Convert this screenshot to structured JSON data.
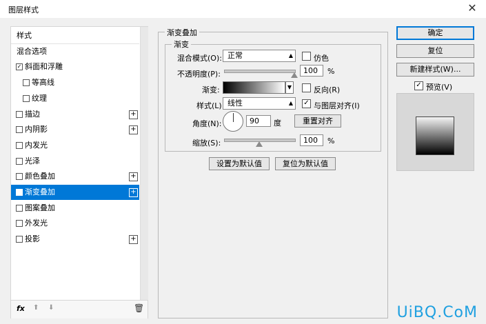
{
  "window": {
    "title": "图层样式",
    "close_glyph": "✕"
  },
  "styles_list": {
    "items": [
      {
        "label": "样式",
        "checkbox": false,
        "checked": false,
        "plus": false,
        "indent": false,
        "selected": false
      },
      {
        "label": "混合选项",
        "checkbox": false,
        "checked": false,
        "plus": false,
        "indent": false,
        "selected": false
      },
      {
        "label": "斜面和浮雕",
        "checkbox": true,
        "checked": true,
        "plus": false,
        "indent": false,
        "selected": false
      },
      {
        "label": "等高线",
        "checkbox": true,
        "checked": false,
        "plus": false,
        "indent": true,
        "selected": false
      },
      {
        "label": "纹理",
        "checkbox": true,
        "checked": false,
        "plus": false,
        "indent": true,
        "selected": false
      },
      {
        "label": "描边",
        "checkbox": true,
        "checked": false,
        "plus": true,
        "indent": false,
        "selected": false
      },
      {
        "label": "内阴影",
        "checkbox": true,
        "checked": false,
        "plus": true,
        "indent": false,
        "selected": false
      },
      {
        "label": "内发光",
        "checkbox": true,
        "checked": false,
        "plus": false,
        "indent": false,
        "selected": false
      },
      {
        "label": "光泽",
        "checkbox": true,
        "checked": false,
        "plus": false,
        "indent": false,
        "selected": false
      },
      {
        "label": "颜色叠加",
        "checkbox": true,
        "checked": false,
        "plus": true,
        "indent": false,
        "selected": false
      },
      {
        "label": "渐变叠加",
        "checkbox": true,
        "checked": true,
        "plus": true,
        "indent": false,
        "selected": true
      },
      {
        "label": "图案叠加",
        "checkbox": true,
        "checked": false,
        "plus": false,
        "indent": false,
        "selected": false
      },
      {
        "label": "外发光",
        "checkbox": true,
        "checked": false,
        "plus": false,
        "indent": false,
        "selected": false
      },
      {
        "label": "投影",
        "checkbox": true,
        "checked": false,
        "plus": true,
        "indent": false,
        "selected": false
      }
    ],
    "bottom": {
      "fx_label": "fx",
      "up_glyph": "⬆",
      "down_glyph": "⬇",
      "trash_glyph": "🗑"
    }
  },
  "gradient_overlay": {
    "section_title": "渐变叠加",
    "group_title": "渐变",
    "blend_mode_label": "混合模式(O):",
    "blend_mode_value": "正常",
    "dither_label": "仿色",
    "dither_checked": false,
    "opacity_label": "不透明度(P):",
    "opacity_value": "100",
    "opacity_unit": "%",
    "opacity_fraction": 1.0,
    "gradient_label": "渐变:",
    "reverse_label": "反向(R)",
    "reverse_checked": false,
    "style_label": "样式(L):",
    "style_value": "线性",
    "align_label": "与图层对齐(I)",
    "align_checked": true,
    "angle_label": "角度(N):",
    "angle_value": "90",
    "angle_unit": "度",
    "reset_align_label": "重置对齐",
    "scale_label": "缩放(S):",
    "scale_value": "100",
    "scale_unit": "%",
    "scale_fraction": 0.5,
    "set_default_label": "设置为默认值",
    "reset_default_label": "复位为默认值"
  },
  "right_panel": {
    "ok_label": "确定",
    "reset_label": "复位",
    "new_style_label": "新建样式(W)...",
    "preview_label": "预览(V)",
    "preview_checked": true
  },
  "watermark": "UiBQ.CoM",
  "colors": {
    "selection": "#0078d7",
    "watermark": "#1fa0e0"
  }
}
